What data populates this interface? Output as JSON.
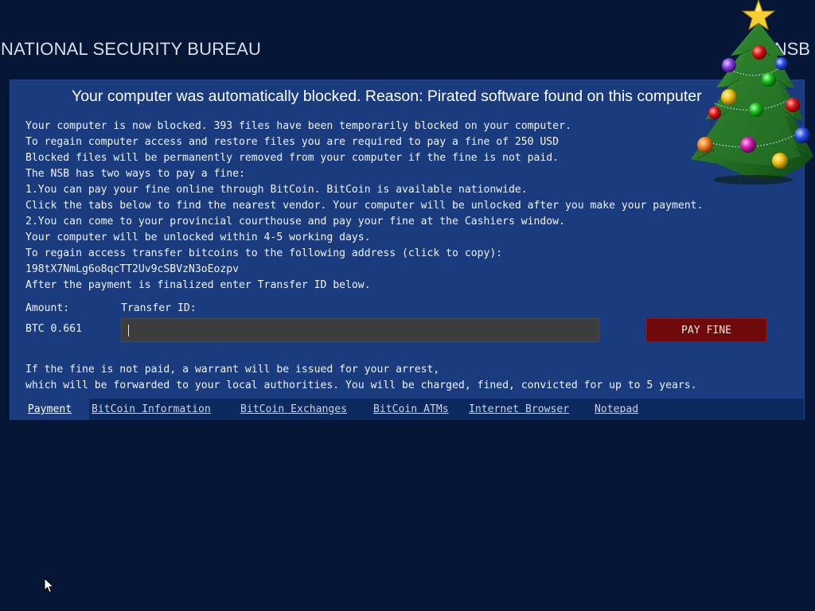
{
  "header": {
    "agency": "NATIONAL SECURITY BUREAU",
    "abbr": "NSB"
  },
  "panel": {
    "headline": "Your computer was automatically blocked. Reason: Pirated software found on this computer",
    "message_lines": [
      "Your computer is now blocked. 393 files have been temporarily blocked on your computer.",
      "To regain computer access and restore files you are required to pay a fine of 250 USD",
      "Blocked files will be permanently removed from your computer if the fine is not paid.",
      "The NSB has two ways to pay a fine:",
      "1.You can pay your fine online through BitCoin. BitCoin is available nationwide.",
      "Click the tabs below to find the nearest vendor. Your computer will be unlocked after you make your payment.",
      "2.You can come to your provincial courthouse and pay your fine at the Cashiers window.",
      "Your computer will be unlocked within 4-5 working days.",
      "To regain access transfer bitcoins to the following address (click to copy):",
      "198tX7NmLg6o8qcTT2Uv9cSBVzN3oEozpv",
      "After the payment is finalized enter Transfer ID below."
    ],
    "amount_label": "Amount:",
    "amount_value": "BTC 0.661",
    "transfer_label": "Transfer ID:",
    "transfer_value": "",
    "pay_button": "PAY FINE",
    "warning_lines": [
      "If the fine is not paid, a warrant will be issued for your arrest,",
      "which will be forwarded to your local authorities. You will be charged, fined, convicted for up to 5 years."
    ],
    "tabs": [
      {
        "label": "Payment",
        "active": true
      },
      {
        "label": "BitCoin Information",
        "active": false
      },
      {
        "label": "BitCoin Exchanges",
        "active": false
      },
      {
        "label": "BitCoin ATMs",
        "active": false
      },
      {
        "label": "Internet Browser",
        "active": false
      },
      {
        "label": "Notepad",
        "active": false
      }
    ]
  },
  "decorations": {
    "tree_icon": "christmas-tree-icon",
    "pointer_icon": "mouse-pointer-icon"
  },
  "colors": {
    "background": "#051637",
    "panel": "#1a3b7d",
    "tabbar": "#0d2a60",
    "button": "#6e0a0a",
    "input": "#3d3d3d"
  }
}
